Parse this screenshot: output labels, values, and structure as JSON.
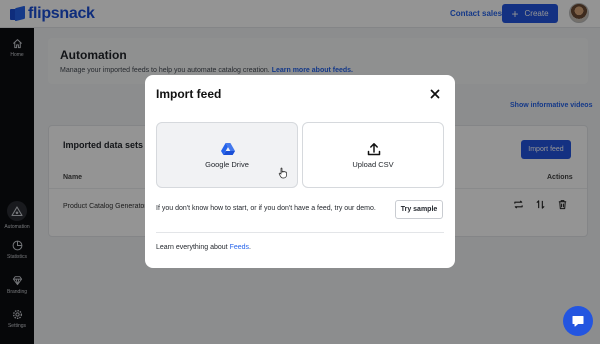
{
  "header": {
    "logo_text": "flipsnack",
    "contact_sales": "Contact sales",
    "create_label": "Create"
  },
  "sidebar": {
    "items": [
      {
        "label": "Home",
        "icon": "home-icon"
      },
      {
        "label": "Automation",
        "icon": "automation-icon"
      },
      {
        "label": "Statistics",
        "icon": "statistics-icon"
      },
      {
        "label": "Branding",
        "icon": "diamond-icon"
      },
      {
        "label": "Settings",
        "icon": "gear-icon"
      }
    ]
  },
  "main": {
    "title": "Automation",
    "description": "Manage your imported feeds to help you automate catalog creation.",
    "learn_more": "Learn more about feeds.",
    "show_videos": "Show informative videos",
    "data_sets": {
      "title": "Imported data sets",
      "import_button": "Import feed",
      "columns": [
        "Name",
        "Actions"
      ],
      "rows": [
        {
          "name": "Product Catalog Generator"
        }
      ]
    }
  },
  "modal": {
    "title": "Import feed",
    "options": [
      {
        "label": "Google Drive",
        "icon": "google-drive-icon"
      },
      {
        "label": "Upload CSV",
        "icon": "upload-icon"
      }
    ],
    "hint": "If you don't know how to start, or if you don't have a feed, try our demo.",
    "try_sample": "Try sample",
    "learn_prefix": "Learn everything about ",
    "learn_link": "Feeds",
    "learn_suffix": "."
  },
  "colors": {
    "accent": "#2355e0",
    "link": "#2563eb",
    "sidebar_bg": "#0c0d10"
  }
}
